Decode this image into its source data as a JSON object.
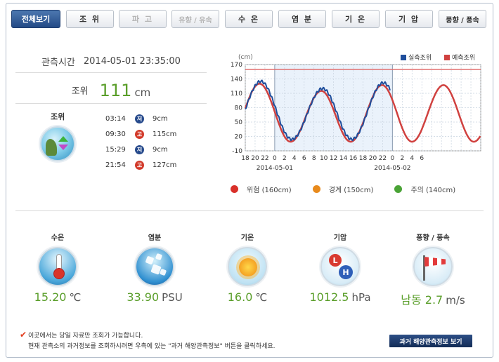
{
  "tabs": [
    {
      "label": "전체보기",
      "state": "active"
    },
    {
      "label": "조 위",
      "state": "normal"
    },
    {
      "label": "파 고",
      "state": "disabled"
    },
    {
      "label": "유향 / 유속",
      "state": "disabled"
    },
    {
      "label": "수 온",
      "state": "normal"
    },
    {
      "label": "염 분",
      "state": "normal"
    },
    {
      "label": "기 온",
      "state": "normal"
    },
    {
      "label": "기 압",
      "state": "normal"
    },
    {
      "label": "풍향 / 풍속",
      "state": "normal"
    }
  ],
  "observation": {
    "time_label": "관측시간",
    "time_value": "2014-05-01 23:35:00",
    "tide_label": "조위",
    "tide_value": "111",
    "tide_unit": "cm"
  },
  "high_low": {
    "title": "조위",
    "rows": [
      {
        "time": "03:14",
        "type": "low",
        "badge": "저",
        "value": "9cm"
      },
      {
        "time": "09:30",
        "type": "high",
        "badge": "고",
        "value": "115cm"
      },
      {
        "time": "15:29",
        "type": "low",
        "badge": "저",
        "value": "9cm"
      },
      {
        "time": "21:54",
        "type": "high",
        "badge": "고",
        "value": "127cm"
      }
    ]
  },
  "chart_data": {
    "type": "line",
    "ylabel": "(cm)",
    "ylim": [
      -10,
      170
    ],
    "yticks": [
      -10,
      20,
      50,
      80,
      110,
      140,
      170
    ],
    "x_hours": [
      -6,
      42
    ],
    "xticks": [
      "18",
      "20",
      "22",
      "0",
      "2",
      "4",
      "6",
      "8",
      "10",
      "12",
      "14",
      "16",
      "18",
      "20",
      "22",
      "0",
      "2",
      "4",
      "6"
    ],
    "date_labels": [
      "2014-05-01",
      "2014-05-02"
    ],
    "threshold_line": 160,
    "observed_range_hours": [
      0,
      24
    ],
    "legend_position": "top-right",
    "series": [
      {
        "name": "실측조위",
        "color": "#1f4e9c",
        "extent_hours": [
          -6,
          23.6
        ]
      },
      {
        "name": "예측조위",
        "color": "#d0413f",
        "extent_hours": [
          -6,
          42
        ]
      }
    ],
    "extrema": [
      {
        "time": "03:14",
        "value": 9
      },
      {
        "time": "09:30",
        "value": 115
      },
      {
        "time": "15:29",
        "value": 9
      },
      {
        "time": "21:54",
        "value": 127
      }
    ]
  },
  "limits": [
    {
      "label": "위험 (160cm)",
      "color": "#d9302a"
    },
    {
      "label": "경계 (150cm)",
      "color": "#e88a1c"
    },
    {
      "label": "주의 (140cm)",
      "color": "#4aa336"
    }
  ],
  "measurements": [
    {
      "title": "수온",
      "value": "15.20",
      "unit": "℃",
      "icon": "thermometer-icon"
    },
    {
      "title": "염분",
      "value": "33.90",
      "unit": "PSU",
      "icon": "salinity-icon"
    },
    {
      "title": "기온",
      "value": "16.0",
      "unit": "℃",
      "icon": "sun-icon"
    },
    {
      "title": "기압",
      "value": "1012.5",
      "unit": "hPa",
      "icon": "pressure-icon"
    },
    {
      "title": "풍향 / 풍속",
      "value": "남동  2.7",
      "unit": "m/s",
      "icon": "windsock-icon"
    }
  ],
  "notice": {
    "line1": "이곳에서는 당일 자료만 조회가 가능합니다.",
    "line2": "현재 관측소의 과거정보를 조회하시려면 우측에 있는 \"과거 해양관측정보\" 버튼을 클릭하세요."
  },
  "past_button": "과거 해양관측정보 보기"
}
